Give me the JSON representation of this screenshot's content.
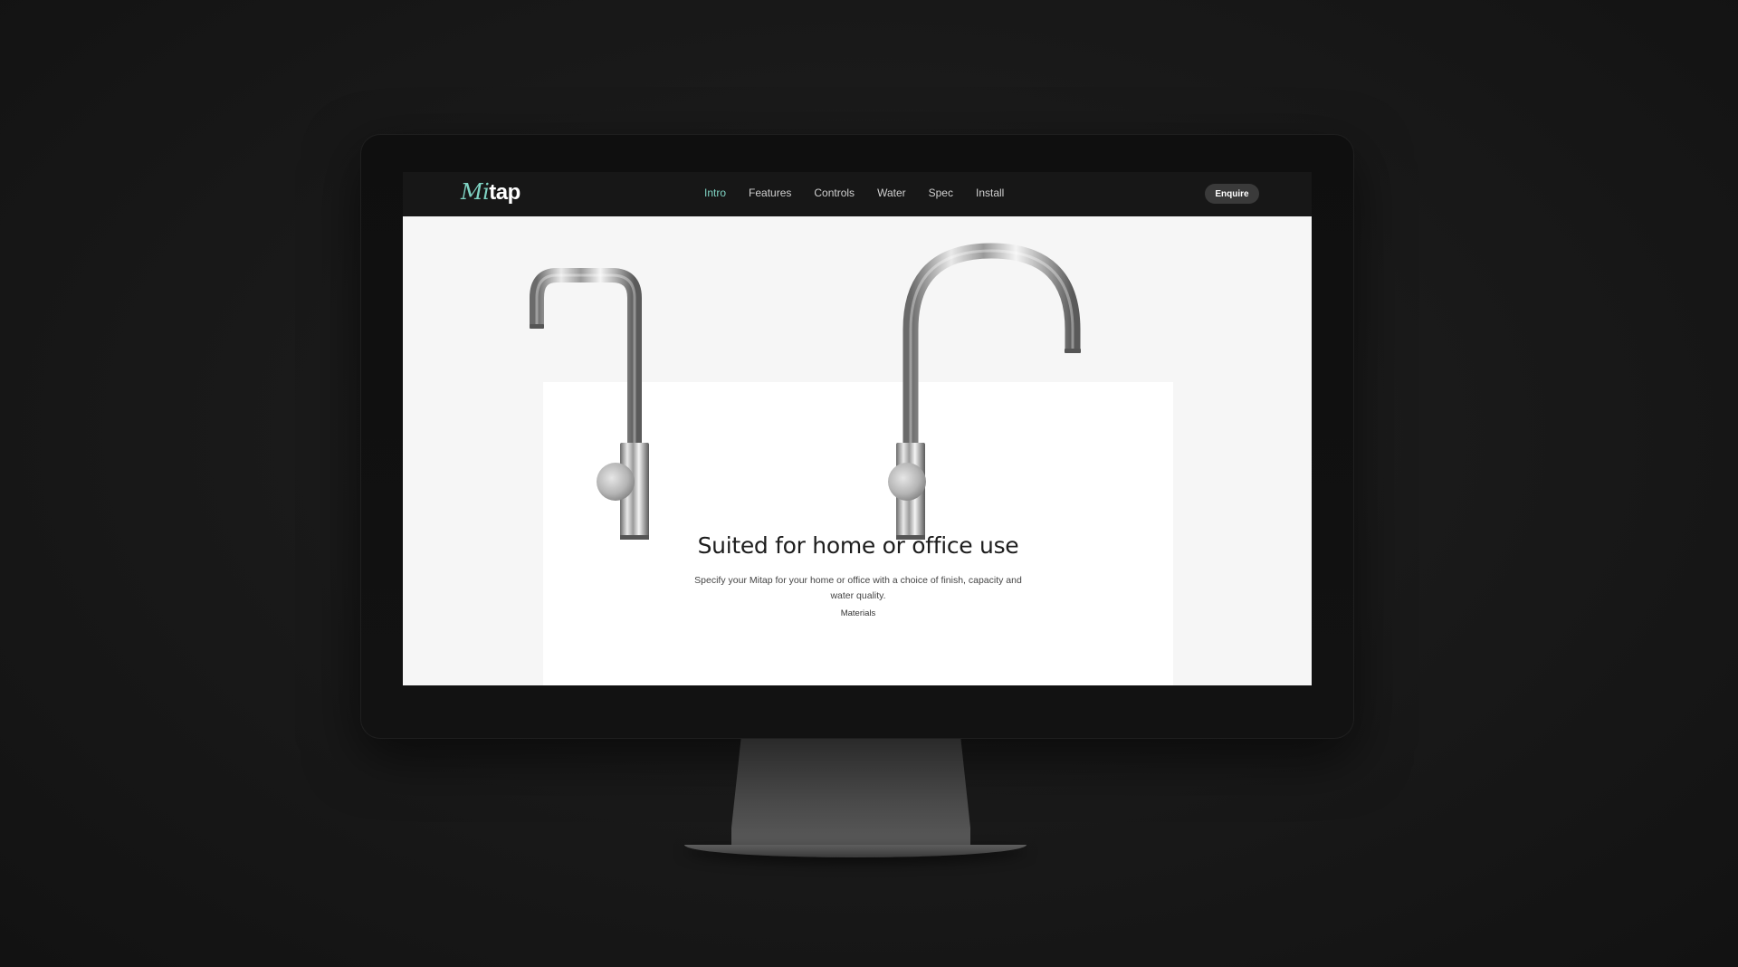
{
  "site": {
    "logo_mi": "Mi",
    "logo_tap": "tap"
  },
  "nav": {
    "items": [
      {
        "label": "Intro",
        "active": true
      },
      {
        "label": "Features",
        "active": false
      },
      {
        "label": "Controls",
        "active": false
      },
      {
        "label": "Water",
        "active": false
      },
      {
        "label": "Spec",
        "active": false
      },
      {
        "label": "Install",
        "active": false
      }
    ],
    "enquire_label": "Enquire"
  },
  "hero": {
    "headline": "Suited for home or office use",
    "subtext": "Specify your Mitap for your home or office with a choice of finish, capacity and water quality.",
    "section_label": "Materials"
  },
  "colors": {
    "accent": "#7fd3c3",
    "header_bg": "#171717",
    "page_bg": "#f6f6f6",
    "button_bg": "#3a3a3a"
  }
}
